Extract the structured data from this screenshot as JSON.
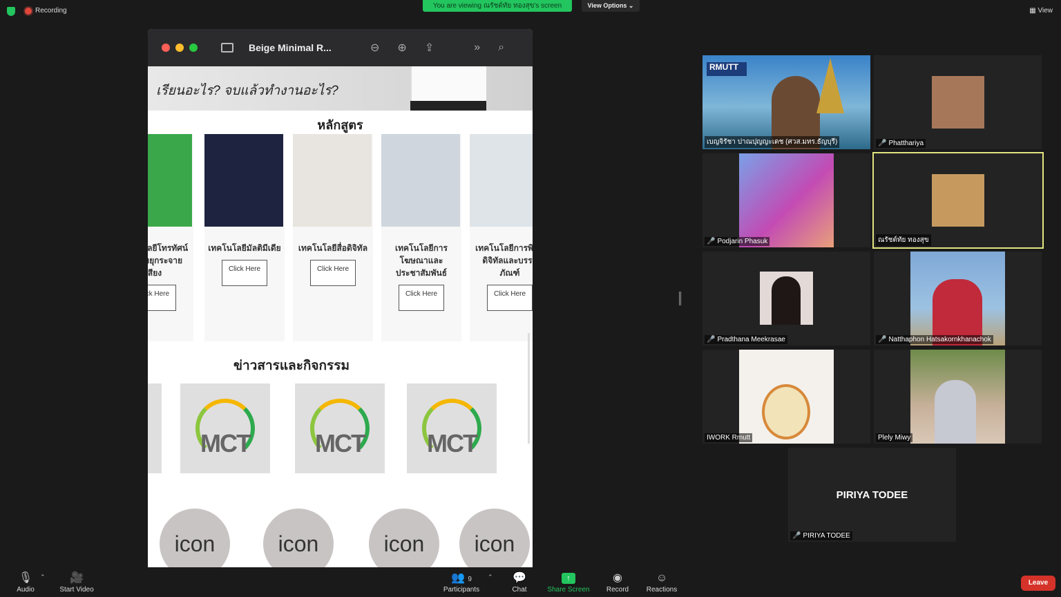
{
  "topbar": {
    "recording_label": "Recording",
    "viewing_banner": "You are viewing ณรัชต์ทัย ทองสุข's screen",
    "view_options_label": "View Options ⌄",
    "view_label": "▦ View"
  },
  "shared_window": {
    "title": "Beige Minimal R...",
    "hero_text": "เรียนอะไร? จบแล้วทำงานอะไร?",
    "courses_title": "หลักสูตร",
    "courses": [
      {
        "name": "เทคโนโลยีโทรทัศน์และวิทยุกระจายเสียง",
        "button": "Click Here",
        "color": "#3aa84a"
      },
      {
        "name": "เทคโนโลยีมัลติมีเดีย",
        "button": "Click Here",
        "color": "#1e2340"
      },
      {
        "name": "เทคโนโลยีสื่อดิจิทัล",
        "button": "Click Here",
        "color": "#e8e4e0"
      },
      {
        "name": "เทคโนโลยีการโฆษณาและประชาสัมพันธ์",
        "button": "Click Here",
        "color": "#cfd6de"
      },
      {
        "name": "เทคโนโลยีการพิมพ์ดิจิทัลและบรรจุภัณฑ์",
        "button": "Click Here",
        "color": "#dfe4e8"
      }
    ],
    "news_title": "ข่าวสารและกิจกรรม",
    "news_logo_text": "MCT",
    "icon_label": "icon"
  },
  "participants": [
    {
      "name": "เบญจิรัชา ปาณปุญญะเดช (ศวส.มทร.ธัญบุรี)",
      "muted": false
    },
    {
      "name": "Phatthariya",
      "muted": true
    },
    {
      "name": "Podjarin Phasuk",
      "muted": true
    },
    {
      "name": "ณรัชต์ทัย ทองสุข",
      "muted": false
    },
    {
      "name": "Pradthana Meekrasae",
      "muted": true
    },
    {
      "name": "Natthaphon Hatsakornkhanachok",
      "muted": true
    },
    {
      "name": "IWORK Rmutt",
      "muted": false
    },
    {
      "name": "Plely Miwy",
      "muted": false
    },
    {
      "name": "PIRIYA TODEE",
      "muted": true
    }
  ],
  "toolbar": {
    "audio": "Audio",
    "start_video": "Start Video",
    "participants": "Participants",
    "participant_count": "9",
    "chat": "Chat",
    "share_screen": "Share Screen",
    "record": "Record",
    "reactions": "Reactions",
    "leave": "Leave"
  }
}
